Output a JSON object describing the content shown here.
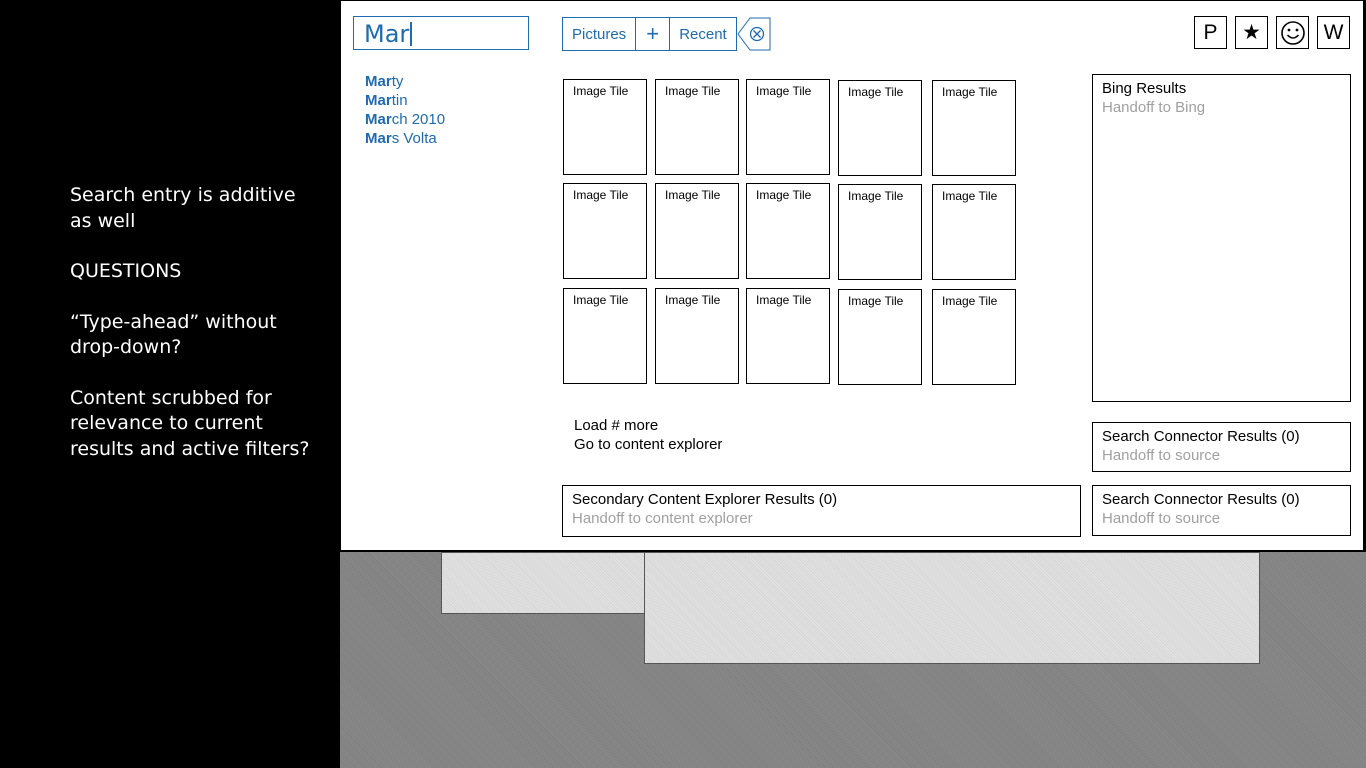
{
  "notes": {
    "line1": "Search entry is additive as well",
    "line2": "QUESTIONS",
    "line3": "“Type-ahead” without drop-down?",
    "line4": "Content scrubbed for relevance to current results and active filters?"
  },
  "search": {
    "value": "Mar"
  },
  "suggestions": [
    {
      "match": "Mar",
      "rest": "ty"
    },
    {
      "match": "Mar",
      "rest": "tin"
    },
    {
      "match": "Mar",
      "rest": "ch 2010"
    },
    {
      "match": "Mar",
      "rest": "s Volta"
    }
  ],
  "filters": {
    "pictures": "Pictures",
    "plus": "+",
    "recent": "Recent",
    "clear_icon": "close-circle-icon"
  },
  "top_icons": {
    "p": "P",
    "star": "★",
    "smiley": "☺",
    "w": "W"
  },
  "tiles": [
    "Image Tile",
    "Image Tile",
    "Image Tile",
    "Image Tile",
    "Image Tile",
    "Image Tile",
    "Image Tile",
    "Image Tile",
    "Image Tile",
    "Image Tile",
    "Image Tile",
    "Image Tile",
    "Image Tile",
    "Image Tile",
    "Image Tile"
  ],
  "links": {
    "load_more": "Load # more",
    "go_explorer": "Go to content explorer"
  },
  "bing": {
    "title": "Bing Results",
    "sub": "Handoff to Bing"
  },
  "connector1": {
    "title": "Search Connector Results (0)",
    "sub": "Handoff to source"
  },
  "connector2": {
    "title": "Search Connector Results (0)",
    "sub": "Handoff to source"
  },
  "secondary": {
    "title": "Secondary Content Explorer Results (0)",
    "sub": "Handoff to content explorer"
  },
  "colors": {
    "accent": "#1e6bb0",
    "muted": "#a0a0a0"
  }
}
